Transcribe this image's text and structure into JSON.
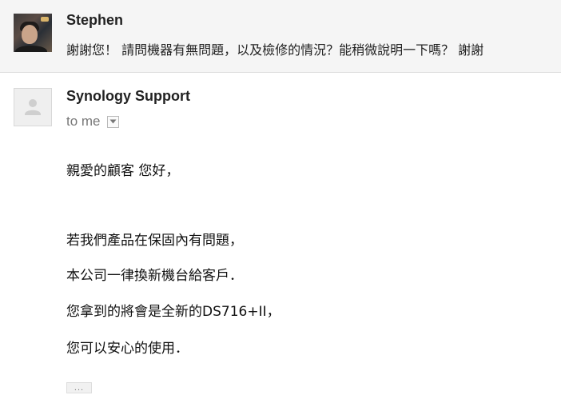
{
  "previous_message": {
    "sender": "Stephen",
    "snippet": "謝謝您！ 請問機器有無問題，以及檢修的情況？能稍微說明一下嗎？ 謝謝"
  },
  "message": {
    "sender": "Synology Support",
    "recipient": "to me",
    "body": [
      "親愛的顧客 您好，",
      "若我們產品在保固內有問題，",
      "本公司一律換新機台給客戶．",
      "您拿到的將會是全新的DS716+II，",
      "您可以安心的使用．"
    ],
    "trimmed_content_label": "..."
  },
  "icons": {
    "avatar_default": "person-silhouette-icon",
    "details_toggle": "dropdown-arrow-icon"
  }
}
